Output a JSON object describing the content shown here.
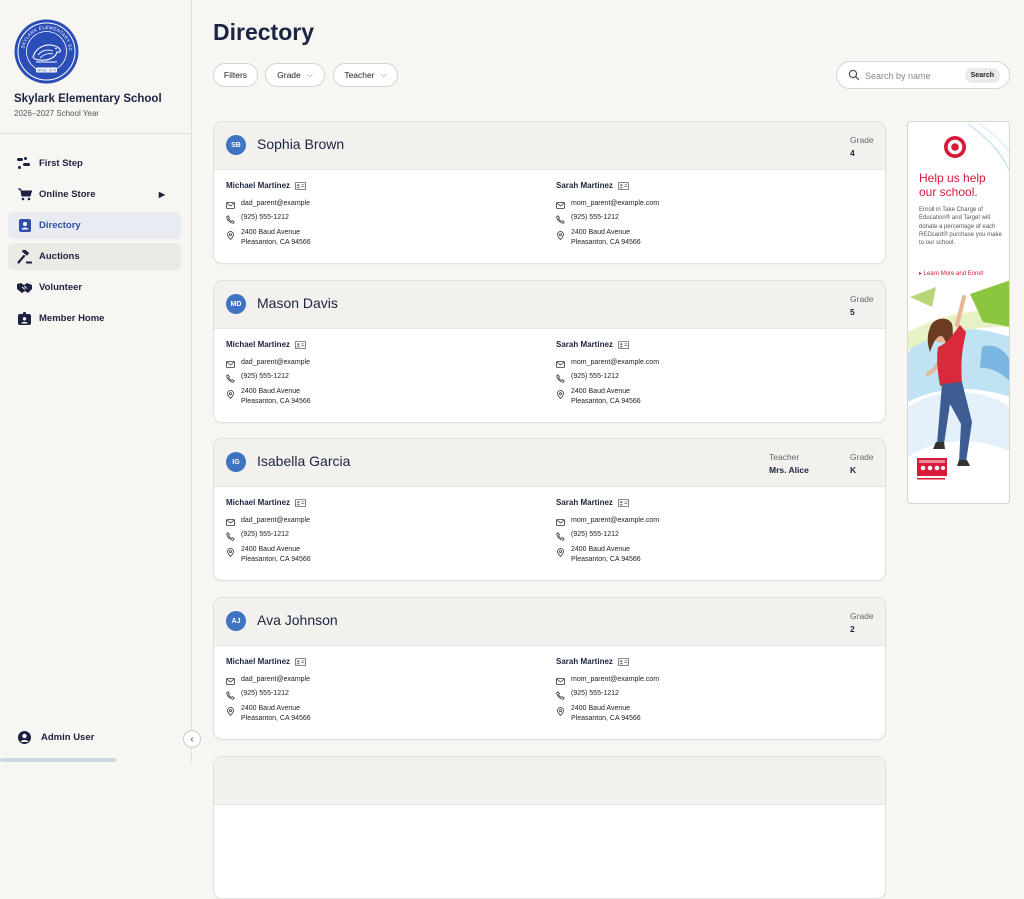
{
  "school": {
    "logo_text": "SKYLARK ELEMENTARY SCHOOL",
    "logo_since": "SINCE 1978",
    "name": "Skylark Elementary School",
    "year": "2026–2027 School Year"
  },
  "nav": {
    "items": [
      {
        "label": "First Step",
        "icon": "footsteps-icon"
      },
      {
        "label": "Online Store",
        "icon": "cart-icon"
      },
      {
        "label": "Directory",
        "icon": "contact-card-icon"
      },
      {
        "label": "Auctions",
        "icon": "gavel-icon"
      },
      {
        "label": "Volunteer",
        "icon": "handshake-icon"
      },
      {
        "label": "Member Home",
        "icon": "member-badge-icon"
      }
    ],
    "active": "Directory"
  },
  "admin": {
    "label": "Admin User"
  },
  "page": {
    "title": "Directory"
  },
  "filters": {
    "filters_label": "Filters",
    "grade_label": "Grade",
    "teacher_label": "Teacher"
  },
  "search": {
    "placeholder": "Search by name",
    "button": "Search"
  },
  "labels": {
    "grade": "Grade",
    "teacher": "Teacher"
  },
  "students": [
    {
      "initials": "SB",
      "name": "Sophia Brown",
      "grade": "4",
      "teacher": null,
      "parents": [
        {
          "name": "Michael Martinez",
          "email": "dad_parent@example",
          "phone": "(925) 555-1212",
          "address1": "2400 Baud Avenue",
          "address2": "Pleasanton, CA 94566"
        },
        {
          "name": "Sarah Martinez",
          "email": "mom_parent@example.com",
          "phone": "(925) 555-1212",
          "address1": "2400 Baud Avenue",
          "address2": "Pleasanton, CA 94566"
        }
      ]
    },
    {
      "initials": "MD",
      "name": "Mason Davis",
      "grade": "5",
      "teacher": null,
      "parents": [
        {
          "name": "Michael Martinez",
          "email": "dad_parent@example",
          "phone": "(925) 555-1212",
          "address1": "2400 Baud Avenue",
          "address2": "Pleasanton, CA 94566"
        },
        {
          "name": "Sarah Martinez",
          "email": "mom_parent@example.com",
          "phone": "(925) 555-1212",
          "address1": "2400 Baud Avenue",
          "address2": "Pleasanton, CA 94566"
        }
      ]
    },
    {
      "initials": "IG",
      "name": "Isabella Garcia",
      "grade": "K",
      "teacher": "Mrs. Alice",
      "parents": [
        {
          "name": "Michael Martinez",
          "email": "dad_parent@example",
          "phone": "(925) 555-1212",
          "address1": "2400 Baud Avenue",
          "address2": "Pleasanton, CA 94566"
        },
        {
          "name": "Sarah Martinez",
          "email": "mom_parent@example.com",
          "phone": "(925) 555-1212",
          "address1": "2400 Baud Avenue",
          "address2": "Pleasanton, CA 94566"
        }
      ]
    },
    {
      "initials": "AJ",
      "name": "Ava Johnson",
      "grade": "2",
      "teacher": null,
      "parents": [
        {
          "name": "Michael Martinez",
          "email": "dad_parent@example",
          "phone": "(925) 555-1212",
          "address1": "2400 Baud Avenue",
          "address2": "Pleasanton, CA 94566"
        },
        {
          "name": "Sarah Martinez",
          "email": "mom_parent@example.com",
          "phone": "(925) 555-1212",
          "address1": "2400 Baud Avenue",
          "address2": "Pleasanton, CA 94566"
        }
      ]
    }
  ],
  "ad": {
    "headline_line1": "Help us help",
    "headline_line2": "our school.",
    "body": "Enroll in Take Charge of Education® and Target will donate a percentage of each REDcard® purchase you make to our school.",
    "link": "▸ Learn More and Enroll",
    "accent_color": "#d71a3a"
  },
  "colors": {
    "accent": "#2f4fa8",
    "avatar": "#3e74c2",
    "background": "#f7f6f3"
  }
}
